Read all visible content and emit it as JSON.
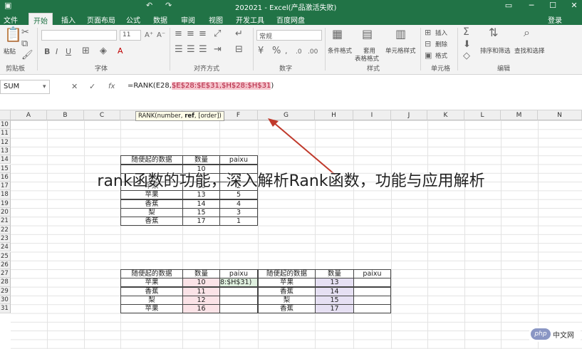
{
  "window": {
    "title": "202021 - Excel(产品激活失败)",
    "controls": [
      "restore-icon",
      "minimize-icon",
      "maximize-icon",
      "close-icon"
    ]
  },
  "ribbon_tabs": [
    "文件",
    "开始",
    "插入",
    "页面布局",
    "公式",
    "数据",
    "审阅",
    "视图",
    "开发工具",
    "百度网盘"
  ],
  "login_label": "登录",
  "ribbon": {
    "paste_label": "粘贴",
    "clipboard_label": "剪贴板",
    "font_group_label": "字体",
    "font_size": "11",
    "align_group_label": "对齐方式",
    "number_format": "常规",
    "number_group_label": "数字",
    "cond_format_label": "条件格式",
    "table_format_label_1": "套用",
    "table_format_label_2": "表格格式",
    "cell_style_label": "单元格样式",
    "styles_group_label": "样式",
    "insert_label": "插入",
    "delete_label": "删除",
    "format_label": "格式",
    "cells_group_label": "单元格",
    "sort_filter_label": "排序和筛选",
    "find_select_label": "查找和选择",
    "edit_group_label": "编辑"
  },
  "formula_bar": {
    "name_box": "SUM",
    "fx_label": "fx",
    "formula_prefix": "=RANK(E28,",
    "formula_ref": "$E$28:$E$31,$H$28:$H$31",
    "formula_suffix": ")",
    "tooltip_prefix": "RANK(number, ",
    "tooltip_bold": "ref",
    "tooltip_suffix": ", [order])"
  },
  "columns": [
    "A",
    "B",
    "C",
    "D",
    "E",
    "F",
    "G",
    "H",
    "I",
    "J",
    "K",
    "L",
    "M",
    "N"
  ],
  "rows": [
    "10",
    "11",
    "12",
    "13",
    "14",
    "15",
    "16",
    "17",
    "18",
    "19",
    "20",
    "21",
    "22",
    "23",
    "24",
    "25",
    "26",
    "27",
    "28",
    "29",
    "30",
    "31"
  ],
  "table1": {
    "headers": [
      "随便起的数据",
      "数量",
      "paixu"
    ],
    "rows": [
      [
        "",
        "10",
        ""
      ],
      [
        "梨",
        "12",
        "6"
      ],
      [
        "苹果",
        "16",
        "2"
      ],
      [
        "苹果",
        "13",
        "5"
      ],
      [
        "香蕉",
        "14",
        "4"
      ],
      [
        "梨",
        "15",
        "3"
      ],
      [
        "香蕉",
        "17",
        "1"
      ]
    ]
  },
  "table2": {
    "headers": [
      "随便起的数据",
      "数量",
      "paixu"
    ],
    "rows": [
      [
        "苹果",
        "10",
        "8:$H$31)"
      ],
      [
        "香蕉",
        "11",
        ""
      ],
      [
        "梨",
        "12",
        ""
      ],
      [
        "苹果",
        "16",
        ""
      ]
    ]
  },
  "table3": {
    "headers": [
      "随便起的数据",
      "数量",
      "paixu"
    ],
    "rows": [
      [
        "苹果",
        "13",
        ""
      ],
      [
        "香蕉",
        "14",
        ""
      ],
      [
        "梨",
        "15",
        ""
      ],
      [
        "香蕉",
        "17",
        ""
      ]
    ]
  },
  "overlay_text": "rank函数的功能，深入解析Rank函数，功能与应用解析",
  "watermark": {
    "logo": "php",
    "site": "中文网"
  },
  "colors": {
    "excel_green": "#217346",
    "ref_pink": "#f5c4cc",
    "ref_blue": "#a9c6f0",
    "arrow": "#c0392b"
  }
}
